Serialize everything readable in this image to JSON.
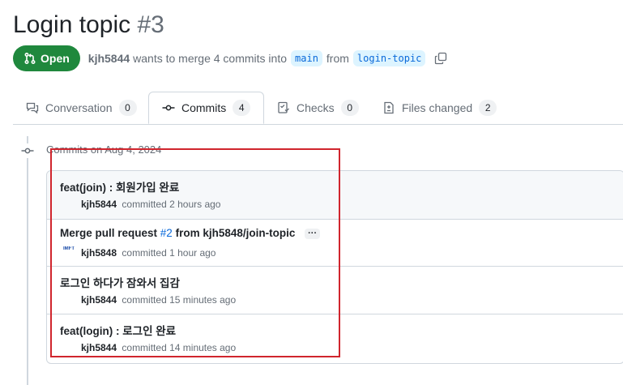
{
  "header": {
    "title": "Login topic",
    "number": "#3"
  },
  "meta": {
    "state": "Open",
    "author": "kjh5844",
    "text_merge": "wants to merge 4 commits into",
    "base_branch": "main",
    "text_from": "from",
    "head_branch": "login-topic"
  },
  "tabs": [
    {
      "label": "Conversation",
      "count": "0"
    },
    {
      "label": "Commits",
      "count": "4"
    },
    {
      "label": "Checks",
      "count": "0"
    },
    {
      "label": "Files changed",
      "count": "2"
    }
  ],
  "timeline": {
    "date_label": "Commits on Aug 4, 2024"
  },
  "commits": [
    {
      "title": "feat(join) : 회원가입 완료",
      "author": "kjh5844",
      "committed": "committed",
      "time": "2 hours ago"
    },
    {
      "title_prefix": "Merge pull request",
      "pr_ref": "#2",
      "title_suffix": "from kjh5848/join-topic",
      "ellipsis": "···",
      "avatar_text": "IMFT",
      "author": "kjh5848",
      "committed": "committed",
      "time": "1 hour ago"
    },
    {
      "title": "로그인 하다가 잠와서 집감",
      "author": "kjh5844",
      "committed": "committed",
      "time": "15 minutes ago"
    },
    {
      "title": "feat(login) : 로그인 완료",
      "author": "kjh5844",
      "committed": "committed",
      "time": "14 minutes ago"
    }
  ],
  "colors": {
    "open": "#1f883d",
    "link": "#0969da",
    "highlight": "#d0252d"
  }
}
